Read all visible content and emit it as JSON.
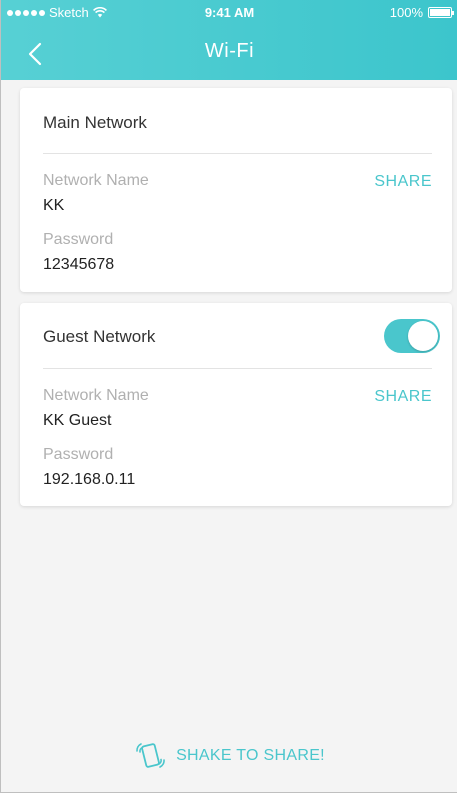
{
  "status_bar": {
    "carrier": "Sketch",
    "time": "9:41 AM",
    "battery": "100%"
  },
  "nav": {
    "back_icon": "chevron-left-icon",
    "title": "Wi-Fi"
  },
  "main_network": {
    "title": "Main Network",
    "name_label": "Network Name",
    "name_value": "KK",
    "password_label": "Password",
    "password_value": "12345678",
    "share_label": "SHARE"
  },
  "guest_network": {
    "title": "Guest Network",
    "enabled": true,
    "name_label": "Network Name",
    "name_value": "KK Guest",
    "password_label": "Password",
    "password_value": "192.168.0.11",
    "share_label": "SHARE"
  },
  "footer": {
    "shake_icon": "shake-phone-icon",
    "shake_label": "SHAKE TO SHARE!"
  },
  "colors": {
    "accent": "#4ac6cc",
    "header": "#3cc5cc"
  }
}
